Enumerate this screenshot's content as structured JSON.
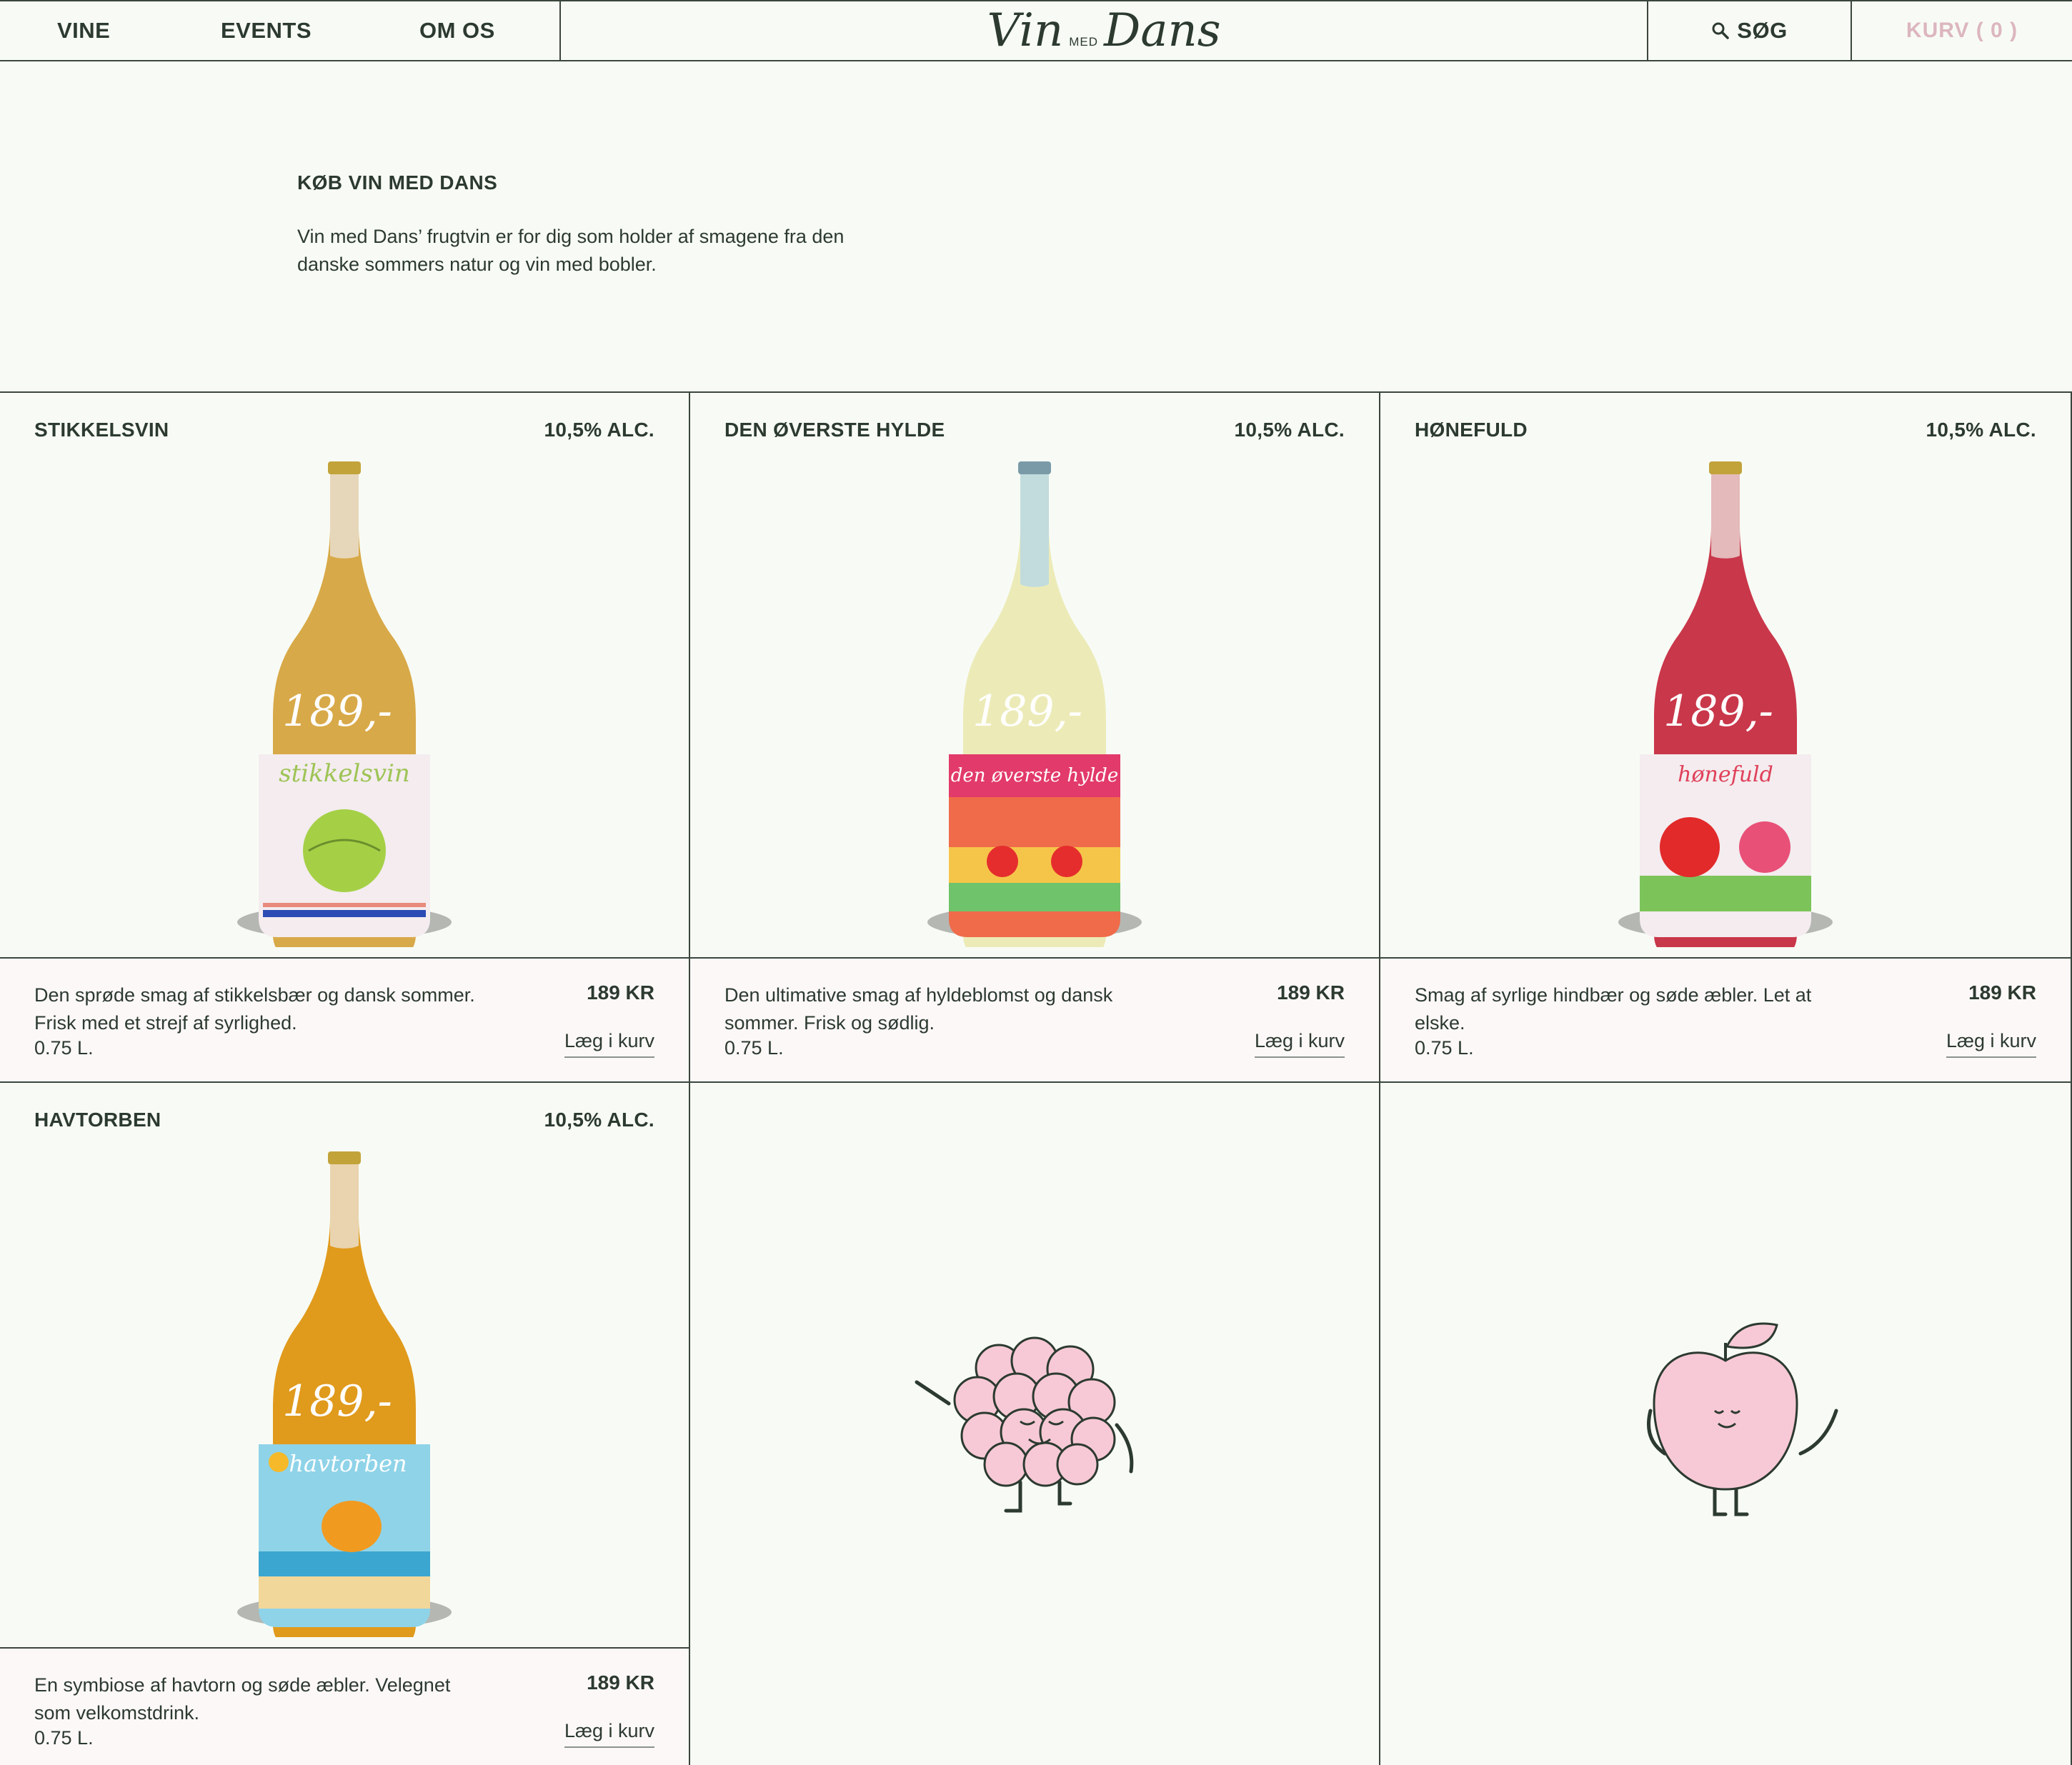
{
  "nav": {
    "items": [
      {
        "label": "VINE"
      },
      {
        "label": "EVENTS"
      },
      {
        "label": "OM OS"
      }
    ],
    "logo": {
      "part1": "Vin",
      "part2": "MED",
      "part3": "Dans"
    },
    "search_label": "SØG",
    "cart_label": "KURV ( 0 )"
  },
  "intro": {
    "title": "KØB VIN MED DANS",
    "text": "Vin med Dans’ frugtvin er for dig som holder af smagene fra den danske sommers natur og vin med bobler."
  },
  "products": [
    {
      "name": "STIKKELSVIN",
      "alc": "10,5% ALC.",
      "description": "Den sprøde smag af stikkelsbær og dansk sommer. Frisk med et strejf af syrlighed.",
      "volume": "0.75 L.",
      "price": "189 KR",
      "add_label": "Læg i kurv",
      "label_text": "stikkelsvin",
      "tag": "189,-"
    },
    {
      "name": "DEN ØVERSTE HYLDE",
      "alc": "10,5% ALC.",
      "description": "Den ultimative smag af hyldeblomst og dansk sommer. Frisk og sødlig.",
      "volume": "0.75 L.",
      "price": "189 KR",
      "add_label": "Læg i kurv",
      "label_text": "den øverste hylde",
      "tag": "189,-"
    },
    {
      "name": "HØNEFULD",
      "alc": "10,5% ALC.",
      "description": "Smag af syrlige hindbær og søde æbler. Let at elske.",
      "volume": "0.75 L.",
      "price": "189 KR",
      "add_label": "Læg i kurv",
      "label_text": "hønefuld",
      "tag": "189,-"
    },
    {
      "name": "HAVTORBEN",
      "alc": "10,5% ALC.",
      "description": "En symbiose af havtorn og søde æbler. Velegnet som velkomstdrink.",
      "volume": "0.75 L.",
      "price": "189 KR",
      "add_label": "Læg i kurv",
      "label_text": "havtorben",
      "tag": "189,-"
    }
  ],
  "colors": {
    "background": "#f8fbf5",
    "ink": "#2c3a30",
    "cart": "#dcb6c0",
    "card_bottom": "#fdf8f8",
    "illustration_pink": "#f7c9d6"
  }
}
